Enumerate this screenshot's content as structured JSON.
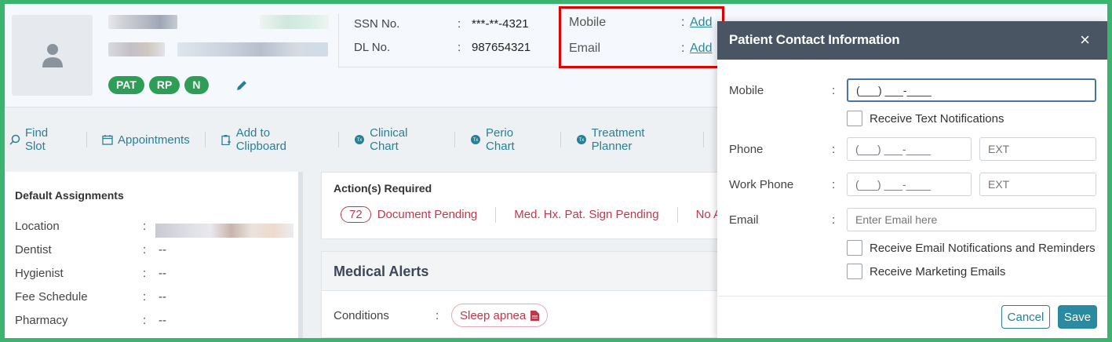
{
  "patient": {
    "tags": [
      "PAT",
      "RP",
      "N"
    ],
    "ssn_label": "SSN No.",
    "ssn_value": "***-**-4321",
    "dl_label": "DL No.",
    "dl_value": "987654321",
    "mobile_label": "Mobile",
    "email_label": "Email",
    "add_label": "Add",
    "colon": ":"
  },
  "toolbar": {
    "items": [
      {
        "label": "Find Slot",
        "icon": "search-icon"
      },
      {
        "label": "Appointments",
        "icon": "calendar-icon"
      },
      {
        "label": "Add to Clipboard",
        "icon": "clipboard-icon"
      },
      {
        "label": "Clinical Chart",
        "icon": "tooth-icon"
      },
      {
        "label": "Perio Chart",
        "icon": "tooth-icon"
      },
      {
        "label": "Treatment Planner",
        "icon": "tooth-icon"
      }
    ]
  },
  "assignments": {
    "title": "Default Assignments",
    "rows": [
      {
        "label": "Location",
        "value": ""
      },
      {
        "label": "Dentist",
        "value": "--"
      },
      {
        "label": "Hygienist",
        "value": "--"
      },
      {
        "label": "Fee Schedule",
        "value": "--"
      },
      {
        "label": "Pharmacy",
        "value": "--"
      }
    ]
  },
  "actions": {
    "title": "Action(s) Required",
    "count": "72",
    "items": [
      "Document Pending",
      "Med. Hx. Pat. Sign Pending",
      "No A"
    ]
  },
  "medical": {
    "title": "Medical Alerts",
    "conditions_label": "Conditions",
    "condition": "Sleep apnea"
  },
  "modal": {
    "title": "Patient Contact Information",
    "close": "×",
    "mobile_label": "Mobile",
    "mobile_value": "(___) ___-____",
    "text_notif": "Receive Text Notifications",
    "phone_label": "Phone",
    "phone_placeholder": "(___) ___-____",
    "ext_placeholder": "EXT",
    "work_label": "Work Phone",
    "email_label": "Email",
    "email_placeholder": "Enter Email here",
    "email_notif": "Receive Email Notifications and Reminders",
    "marketing": "Receive Marketing Emails",
    "cancel": "Cancel",
    "save": "Save"
  },
  "colors": {
    "accent": "#2a7f94",
    "tag_green": "#2e9e57",
    "alert_red": "#c0394b",
    "modal_header": "#4a5563",
    "highlight": "#e00000"
  }
}
